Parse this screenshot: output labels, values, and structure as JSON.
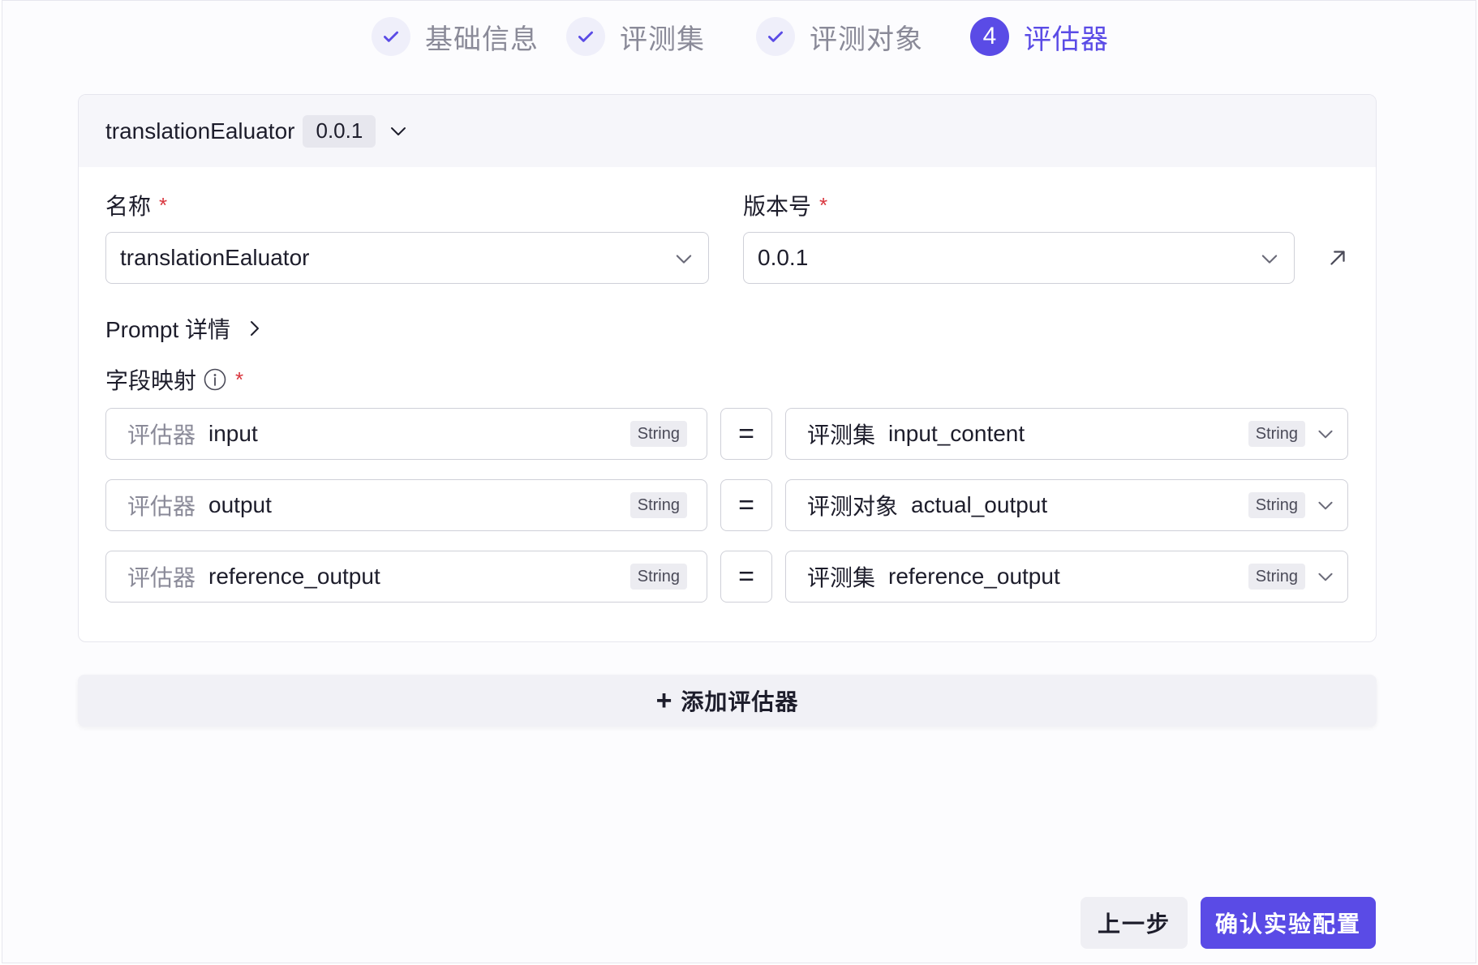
{
  "stepper": {
    "steps": [
      {
        "label": "基础信息",
        "status": "done",
        "icon": "check-icon"
      },
      {
        "label": "评测集",
        "status": "done",
        "icon": "check-icon"
      },
      {
        "label": "评测对象",
        "status": "done",
        "icon": "check-icon"
      },
      {
        "label": "评估器",
        "status": "active",
        "number": "4"
      }
    ]
  },
  "evaluator": {
    "header_title": "translationEaluator",
    "header_version": "0.0.1",
    "name_label": "名称",
    "name_value": "translationEaluator",
    "version_label": "版本号",
    "version_value": "0.0.1",
    "required_mark": "*",
    "prompt_detail": "Prompt 详情",
    "mapping_label": "字段映射",
    "mappings": [
      {
        "left_source": "评估器",
        "left_field": "input",
        "left_type": "String",
        "equals": "=",
        "right_source": "评测集",
        "right_field": "input_content",
        "right_type": "String"
      },
      {
        "left_source": "评估器",
        "left_field": "output",
        "left_type": "String",
        "equals": "=",
        "right_source": "评测对象",
        "right_field": "actual_output",
        "right_type": "String"
      },
      {
        "left_source": "评估器",
        "left_field": "reference_output",
        "left_type": "String",
        "equals": "=",
        "right_source": "评测集",
        "right_field": "reference_output",
        "right_type": "String"
      }
    ]
  },
  "add_evaluator": {
    "plus": "+",
    "label": "添加评估器"
  },
  "footer": {
    "prev_label": "上一步",
    "confirm_label": "确认实验配置"
  },
  "colors": {
    "accent": "#5a4be6",
    "required": "#d9363e",
    "muted": "#8a8a98"
  }
}
